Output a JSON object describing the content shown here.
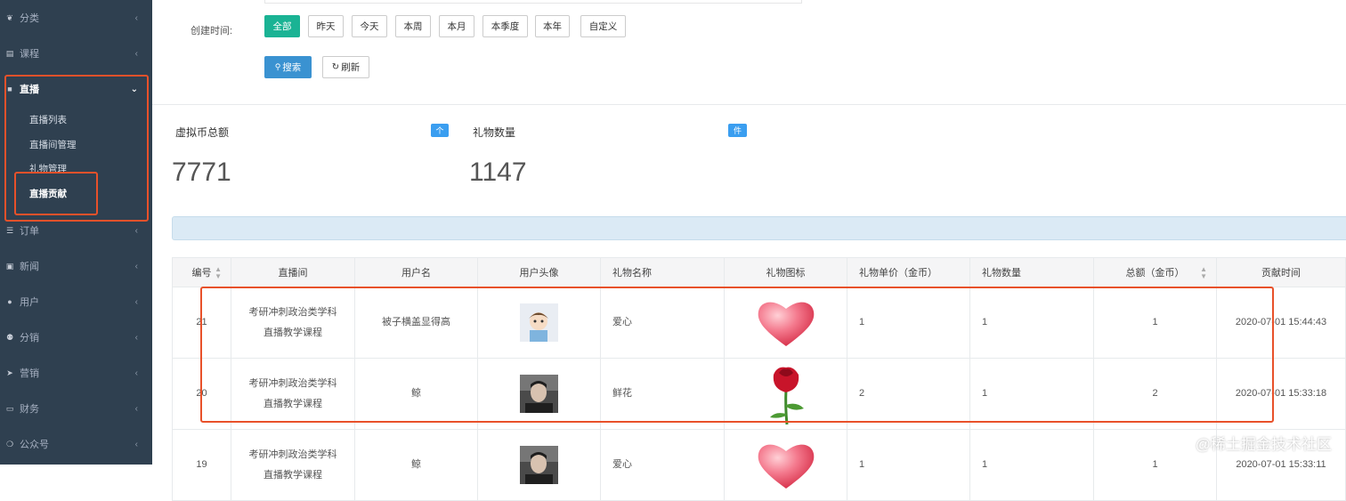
{
  "sidebar": {
    "items": [
      {
        "label": "分类",
        "icon": "leaf-icon"
      },
      {
        "label": "课程",
        "icon": "book-icon"
      },
      {
        "label": "直播",
        "icon": "video-icon"
      },
      {
        "label": "订单",
        "icon": "list-icon"
      },
      {
        "label": "新闻",
        "icon": "image-icon"
      },
      {
        "label": "用户",
        "icon": "user-icon"
      },
      {
        "label": "分销",
        "icon": "users-icon"
      },
      {
        "label": "营销",
        "icon": "send-icon"
      },
      {
        "label": "财务",
        "icon": "money-icon"
      },
      {
        "label": "公众号",
        "icon": "wechat-icon"
      }
    ],
    "live_sub": [
      "直播列表",
      "直播间管理",
      "礼物管理",
      "直播贡献"
    ]
  },
  "filter": {
    "created_label": "创建时间:",
    "ranges": [
      "全部",
      "昨天",
      "今天",
      "本周",
      "本月",
      "本季度",
      "本年",
      "自定义"
    ],
    "search_label": "搜索",
    "refresh_label": "刷新"
  },
  "stats": {
    "coin_title": "虚拟币总额",
    "coin_badge": "个",
    "coin_value": "7771",
    "gift_title": "礼物数量",
    "gift_badge": "件",
    "gift_value": "1147"
  },
  "table": {
    "headers": [
      "编号",
      "直播间",
      "用户名",
      "用户头像",
      "礼物名称",
      "礼物图标",
      "礼物单价（金币）",
      "礼物数量",
      "总额（金币）",
      "贡献时间"
    ],
    "rows": [
      {
        "id": "21",
        "room1": "考研冲刺政治类学科",
        "room2": "直播教学课程",
        "user": "被子横盖显得高",
        "avatar": "cartoon-avatar",
        "gift": "爱心",
        "icon": "heart-icon",
        "price": "1",
        "qty": "1",
        "total": "1",
        "time": "2020-07-01 15:44:43"
      },
      {
        "id": "20",
        "room1": "考研冲刺政治类学科",
        "room2": "直播教学课程",
        "user": "鲸",
        "avatar": "photo-avatar",
        "gift": "鲜花",
        "icon": "rose-icon",
        "price": "2",
        "qty": "1",
        "total": "2",
        "time": "2020-07-01 15:33:18"
      },
      {
        "id": "19",
        "room1": "考研冲刺政治类学科",
        "room2": "直播教学课程",
        "user": "鲸",
        "avatar": "photo-avatar",
        "gift": "爱心",
        "icon": "heart-icon",
        "price": "1",
        "qty": "1",
        "total": "1",
        "time": "2020-07-01 15:33:11"
      }
    ]
  },
  "watermark": "@稀土掘金技术社区",
  "colors": {
    "sidebar": "#2f4050",
    "accent": "#1ab394",
    "primary": "#3a92d1",
    "highlight": "#e8512a"
  }
}
